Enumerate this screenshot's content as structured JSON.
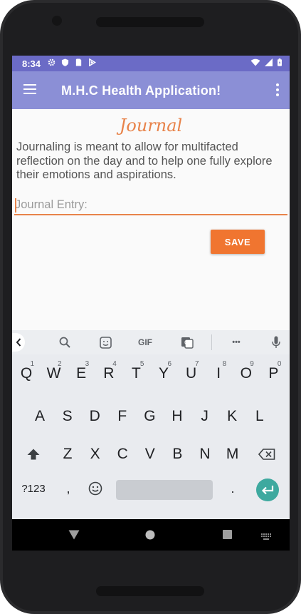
{
  "status_bar": {
    "time": "8:34",
    "left_icons": [
      "gear-icon",
      "shield-icon",
      "sim-card-icon",
      "play-icon"
    ],
    "right_icons": [
      "wifi-icon",
      "signal-icon",
      "battery-icon"
    ]
  },
  "app_bar": {
    "title": "M.H.C Health Application!",
    "color": "#8b8fd6",
    "status_color": "#6b6bc6"
  },
  "journal": {
    "heading": "Journal",
    "description": "Journaling is meant to allow for multifacted reflection on the day and to help one fully explore their emotions and aspirations.",
    "input_placeholder": "Journal Entry:",
    "input_value": "",
    "save_label": "SAVE",
    "accent": "#e8834a",
    "button_color": "#f07530"
  },
  "keyboard": {
    "toolbar": {
      "gif_label": "GIF",
      "more_label": "•••",
      "icons": [
        "back-chevron-icon",
        "search-icon",
        "sticker-icon",
        "gif-icon",
        "translate-icon",
        "more-icon",
        "microphone-icon"
      ]
    },
    "row1": [
      {
        "key": "Q",
        "hint": "1"
      },
      {
        "key": "W",
        "hint": "2"
      },
      {
        "key": "E",
        "hint": "3"
      },
      {
        "key": "R",
        "hint": "4"
      },
      {
        "key": "T",
        "hint": "5"
      },
      {
        "key": "Y",
        "hint": "6"
      },
      {
        "key": "U",
        "hint": "7"
      },
      {
        "key": "I",
        "hint": "8"
      },
      {
        "key": "O",
        "hint": "9"
      },
      {
        "key": "P",
        "hint": "0"
      }
    ],
    "row2": [
      "A",
      "S",
      "D",
      "F",
      "G",
      "H",
      "J",
      "K",
      "L"
    ],
    "row3": [
      "Z",
      "X",
      "C",
      "V",
      "B",
      "N",
      "M"
    ],
    "symbols_label": "?123",
    "comma_label": ",",
    "period_label": ".",
    "enter_color": "#3ea99f"
  },
  "nav_bar": {
    "icons": [
      "back-triangle-icon",
      "home-circle-icon",
      "recents-square-icon",
      "keyboard-switch-icon"
    ]
  }
}
